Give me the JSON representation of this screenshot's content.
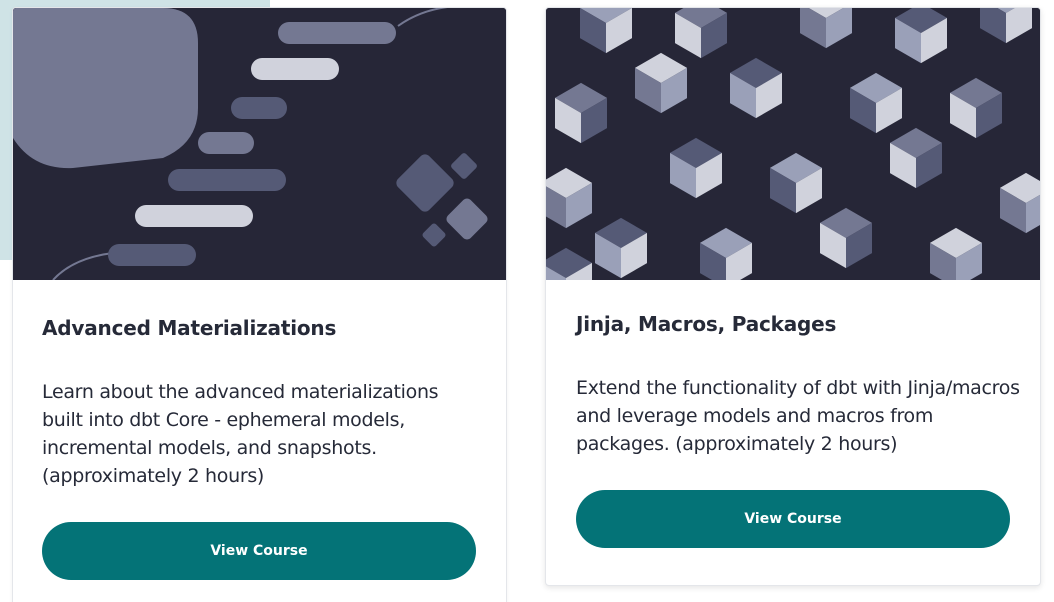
{
  "colors": {
    "card_image_bg": "#262637",
    "button_bg": "#047377",
    "button_text": "#ffffff",
    "title_text": "#262a38",
    "accent_light": "#cfe3e6"
  },
  "courses": [
    {
      "title": "Advanced Materializations",
      "description": "Learn about the advanced materializations built into dbt Core - ephemeral models, incremental models, and snapshots. (approximately 2 hours)",
      "button_label": "View Course",
      "image_icon": "stacked-bars-illustration"
    },
    {
      "title": "Jinja, Macros, Packages",
      "description": "Extend the functionality of dbt with Jinja/macros and leverage models and macros from packages. (approximately 2 hours)",
      "button_label": "View Course",
      "image_icon": "cubes-pattern-illustration"
    }
  ]
}
